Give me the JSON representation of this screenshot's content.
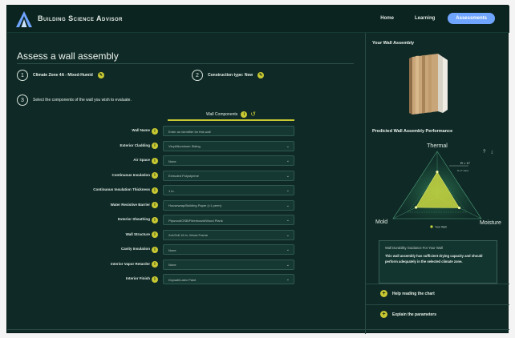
{
  "app": {
    "title": "Building Science Advisor",
    "nav": [
      {
        "label": "Home",
        "active": false
      },
      {
        "label": "Learning",
        "active": false
      },
      {
        "label": "Assessments",
        "active": true
      }
    ]
  },
  "colors": {
    "background": "#0f2a26",
    "accent_yellow": "#c7c832",
    "nav_active": "#6fa5ff",
    "radar_fill": "#c9d640"
  },
  "left": {
    "title": "Assess a wall assembly",
    "step1": {
      "number": "1",
      "label": "Climate Zone 4A - Mixed-Humid"
    },
    "step2": {
      "number": "2",
      "label": "Construction type: New"
    },
    "step3": {
      "number": "3",
      "label": "Select the components of the wall you wish to evaluate."
    },
    "components_header": "Wall Components",
    "rows": [
      {
        "label": "Wall Name",
        "value": "Enter an identifier for this wall",
        "type": "text"
      },
      {
        "label": "Exterior Cladding",
        "value": "Vinyl/Aluminum Siding",
        "type": "select"
      },
      {
        "label": "Air Space",
        "value": "None",
        "type": "select"
      },
      {
        "label": "Continuous Insulation",
        "value": "Extruded Polystyrene",
        "type": "select"
      },
      {
        "label": "Continuous Insulation Thickness",
        "value": "1 in.",
        "type": "select"
      },
      {
        "label": "Water Resistive Barrier",
        "value": "Housewrap/Building Paper (<1 perm)",
        "type": "select"
      },
      {
        "label": "Exterior Sheathing",
        "value": "Plywood/OSB/Fiberboard/Wood Plank",
        "type": "select"
      },
      {
        "label": "Wall Structure",
        "value": "2x4/2x6 16 in. Wood Frame",
        "type": "select"
      },
      {
        "label": "Cavity Insulation",
        "value": "None",
        "type": "select"
      },
      {
        "label": "Interior Vapor Retarder",
        "value": "None",
        "type": "select"
      },
      {
        "label": "Interior Finish",
        "value": "Drywall/Latex Paint",
        "type": "select"
      }
    ]
  },
  "right": {
    "assembly_title": "Your Wall Assembly",
    "performance_title": "Predicted Wall Assembly Performance",
    "axes": {
      "thermal": "Thermal",
      "mold": "Mold",
      "moisture": "Moisture"
    },
    "callout": "R = 17",
    "callout_sub": "R-17 class",
    "legend": "Your Wall",
    "scores": {
      "thermal": 0.55,
      "mold": 0.48,
      "moisture": 0.5
    },
    "guidance_title": "Wall Durability Guidance For Your Wall",
    "guidance_body": "This wall assembly has sufficient drying capacity and should perform adequately in the selected climate zone.",
    "accordion": [
      {
        "label": "Help reading the chart"
      },
      {
        "label": "Explain the parameters"
      }
    ]
  }
}
